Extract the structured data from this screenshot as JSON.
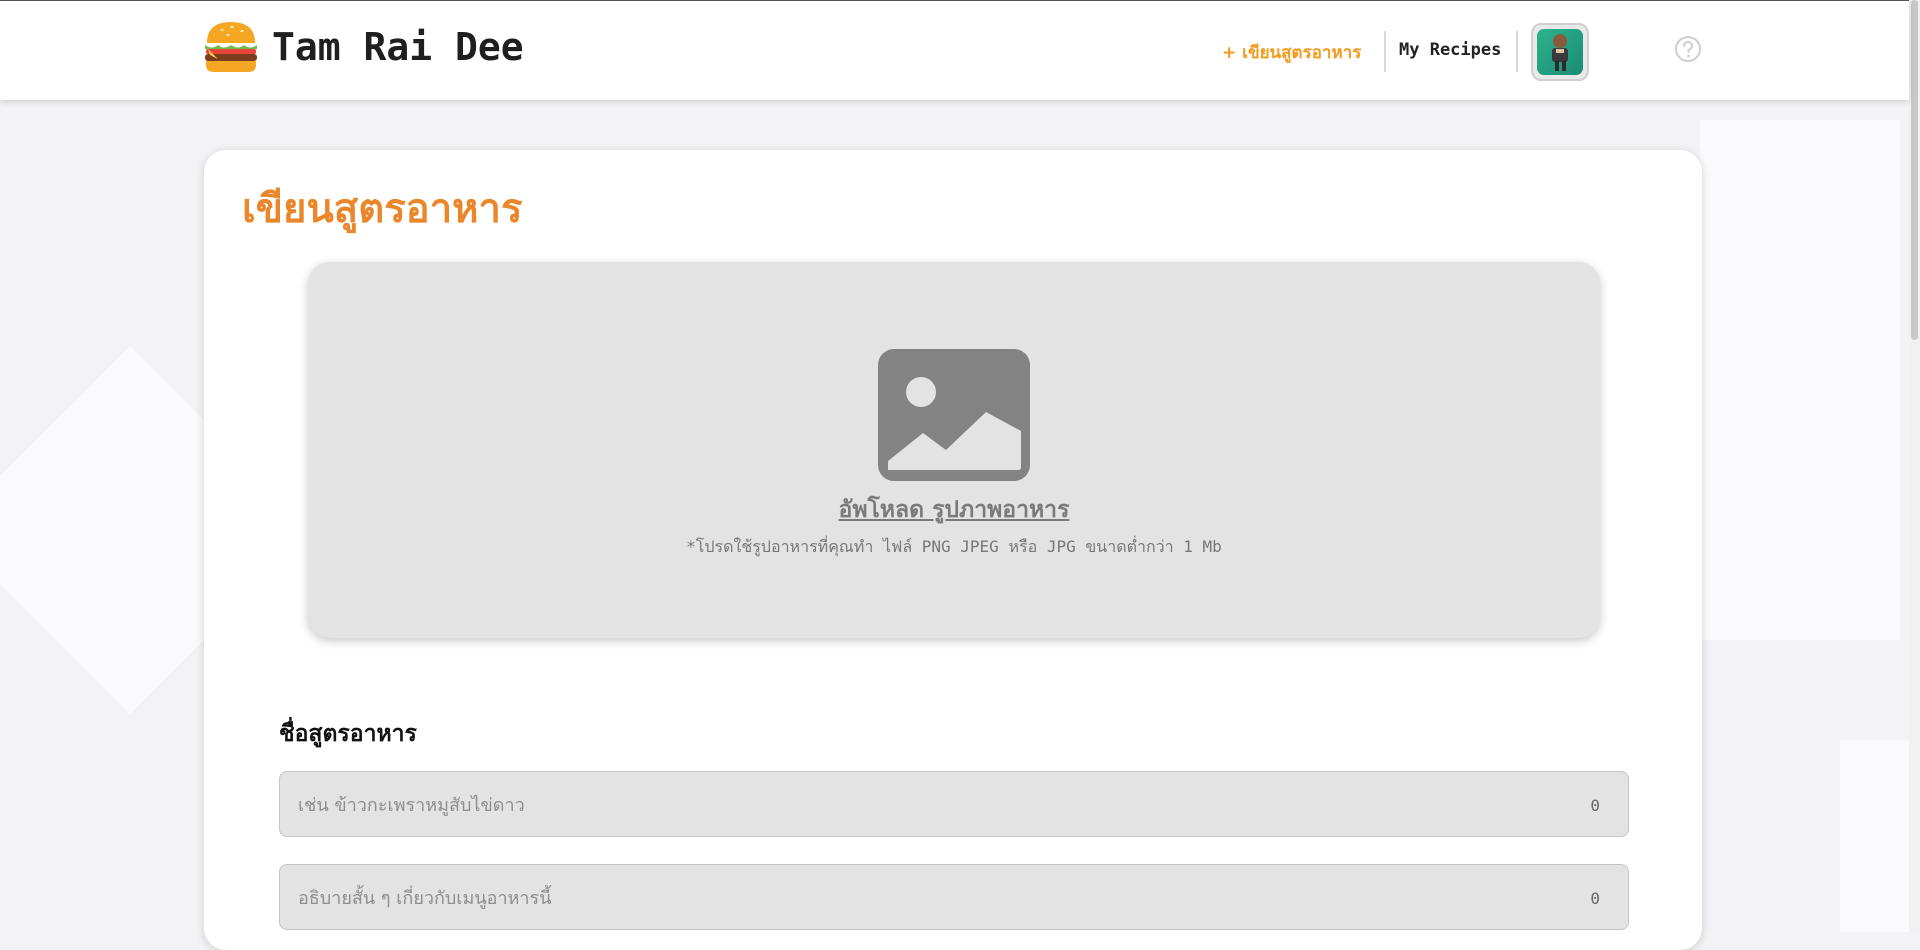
{
  "header": {
    "brand_name": "Tam Rai Dee",
    "logo_icon": "burger-icon",
    "nav_write_label": "+ เขียนสูตรอาหาร",
    "nav_recipes_label": "My Recipes",
    "avatar_icon": "user-avatar",
    "help_icon": "help-circle-icon"
  },
  "main": {
    "title": "เขียนสูตรอาหาร",
    "upload": {
      "icon": "image-placeholder-icon",
      "title": "อัพโหลด  รูปภาพอาหาร",
      "hint": "*โปรดใช้รูปอาหารที่คุณทำ ไฟล์ PNG JPEG หรือ JPG ขนาดต่ำกว่า 1 Mb"
    },
    "name_label": "ชื่อสูตรอาหาร",
    "name_field": {
      "value": "",
      "placeholder": "เช่น ข้าวกะเพราหมูสับไข่ดาว",
      "counter": "0"
    },
    "desc_field": {
      "value": "",
      "placeholder": "อธิบายสั้น ๆ เกี่ยวกับเมนูอาหารนี้",
      "counter": "0"
    }
  },
  "colors": {
    "accent": "#e9872a",
    "nav_accent": "#f39a1d",
    "upload_bg": "#e3e3e3",
    "page_bg": "#f3f3f6"
  }
}
